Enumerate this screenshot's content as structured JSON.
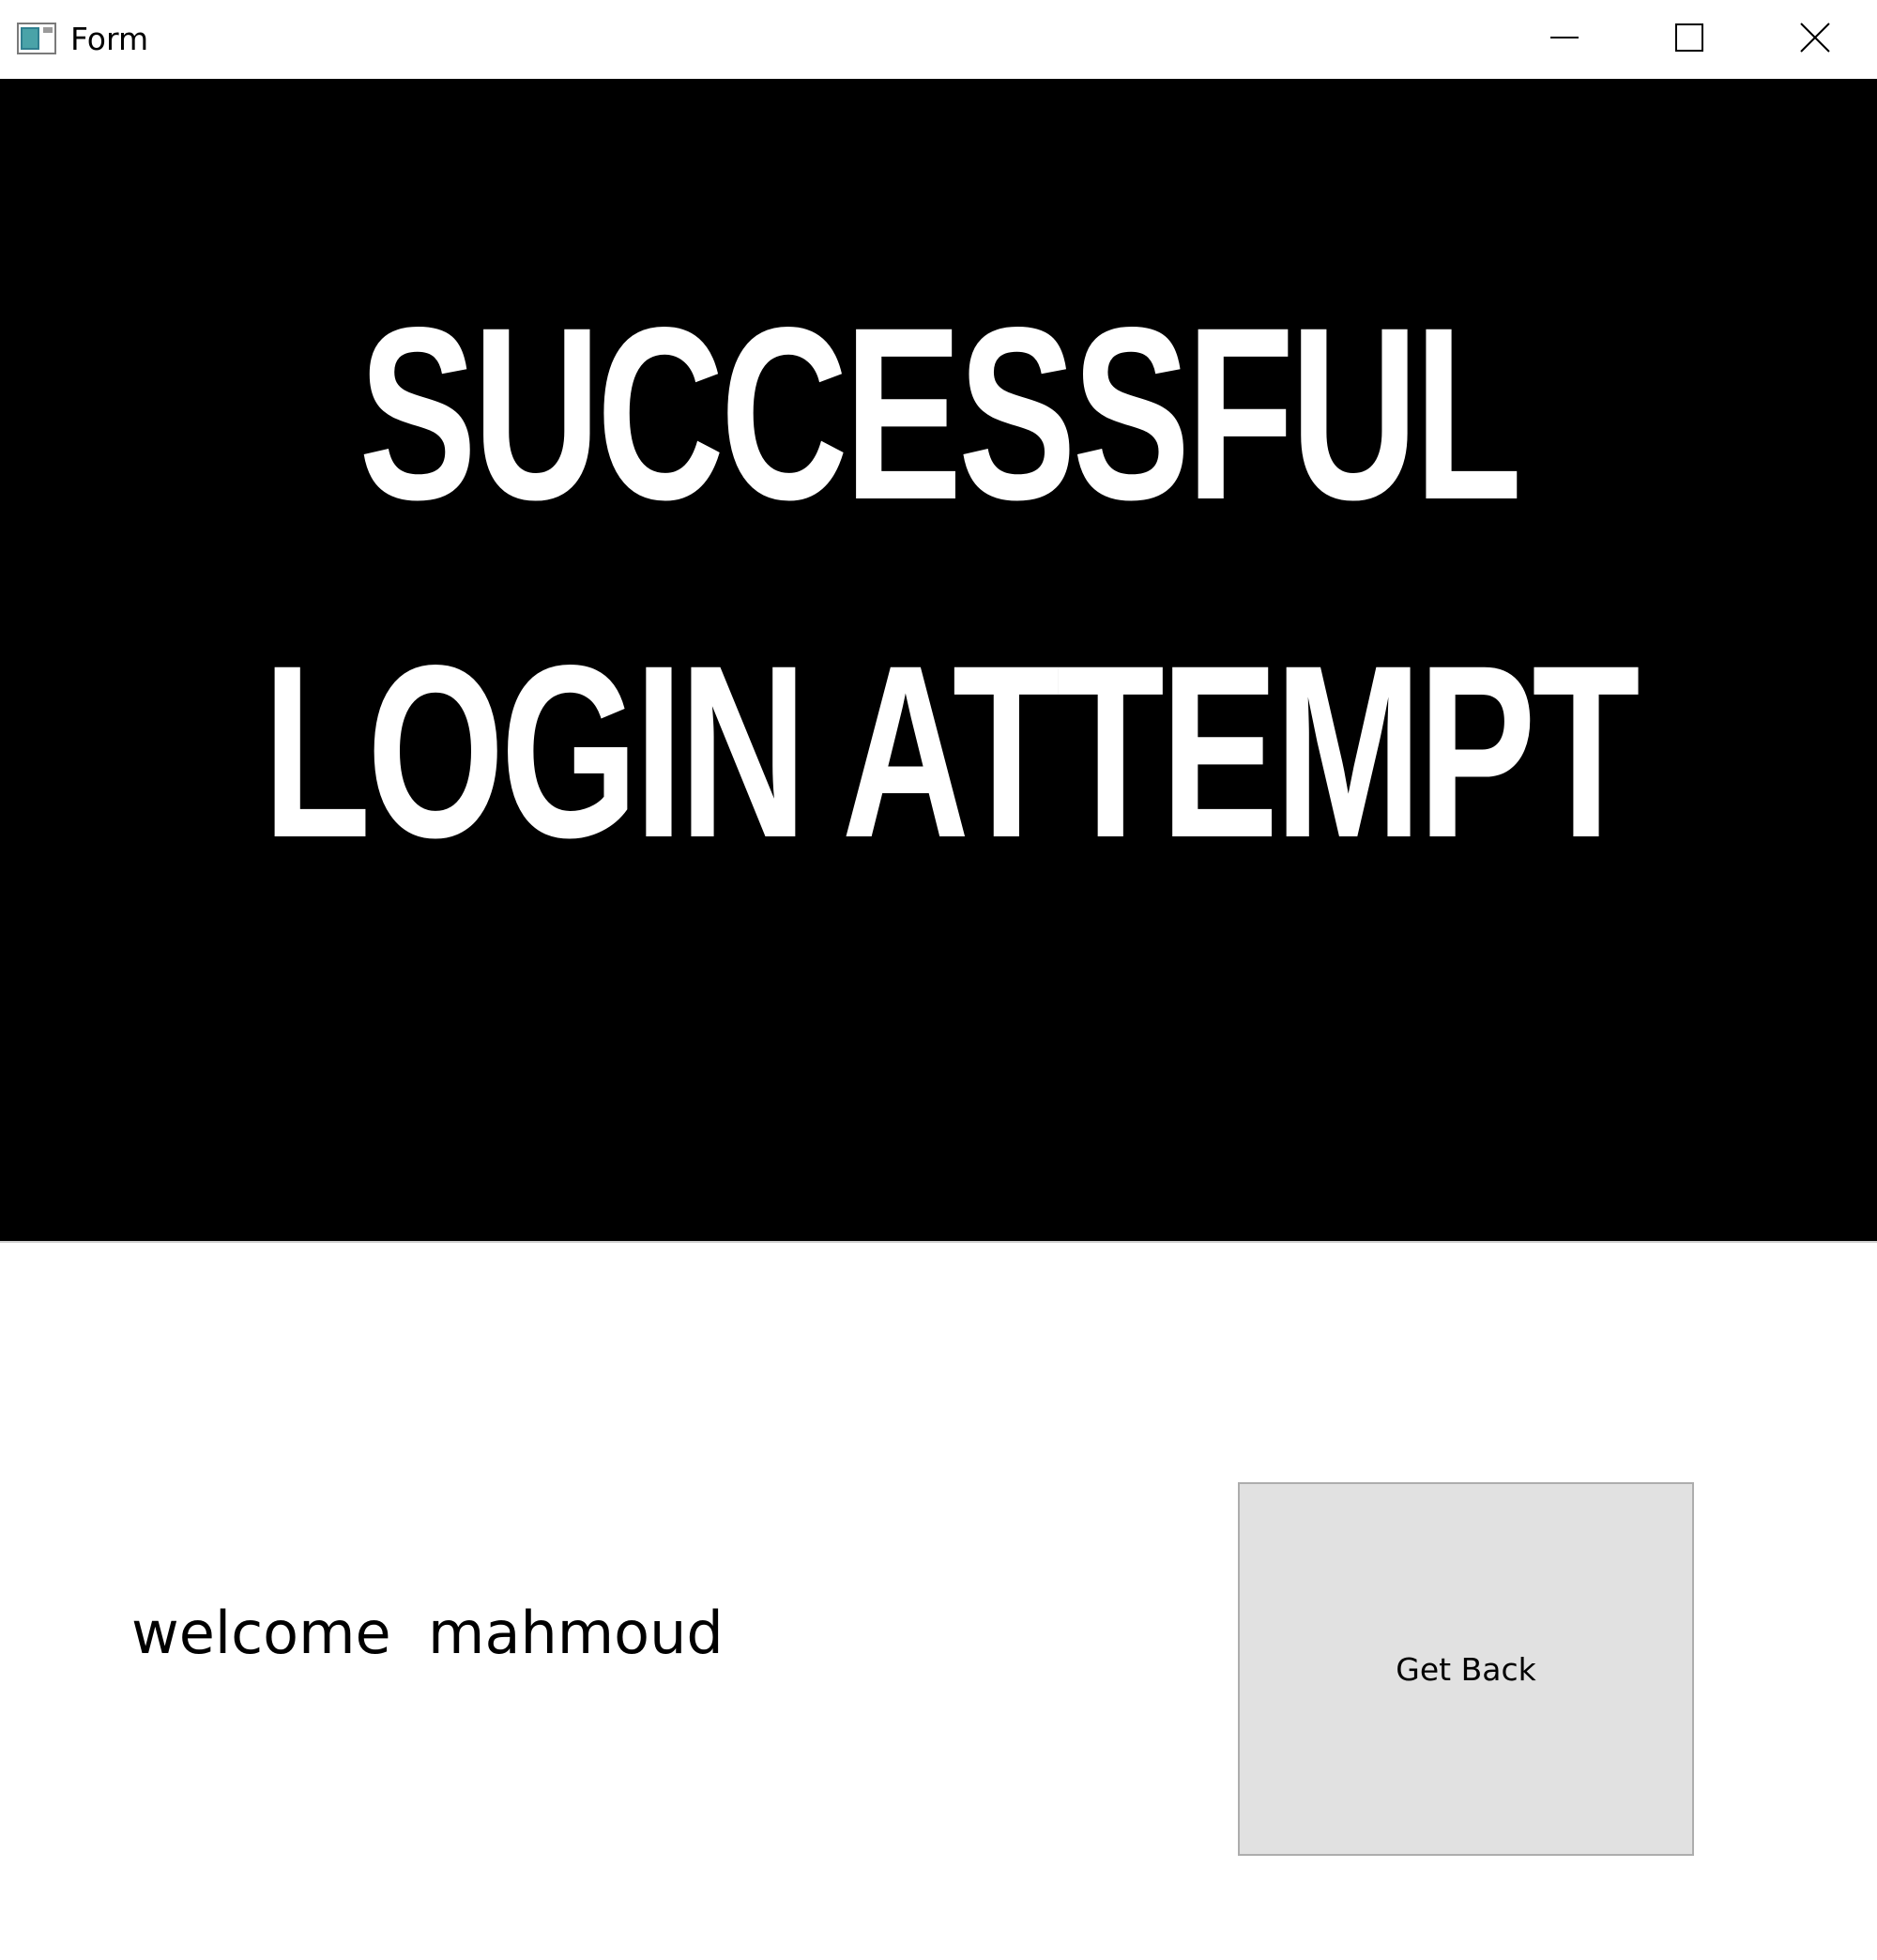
{
  "window": {
    "title": "Form",
    "controls": {
      "minimize": "minimize-icon",
      "maximize": "maximize-icon",
      "close": "close-icon"
    }
  },
  "banner": {
    "line1": "SUCCESSFUL",
    "line2": "LOGIN ATTEMPT",
    "background_color": "#000000",
    "text_color": "#ffffff"
  },
  "content": {
    "welcome_text": "welcome  mahmoud",
    "get_back_label": "Get Back"
  },
  "colors": {
    "button_background": "#e1e1e1",
    "button_border": "#adadad"
  }
}
